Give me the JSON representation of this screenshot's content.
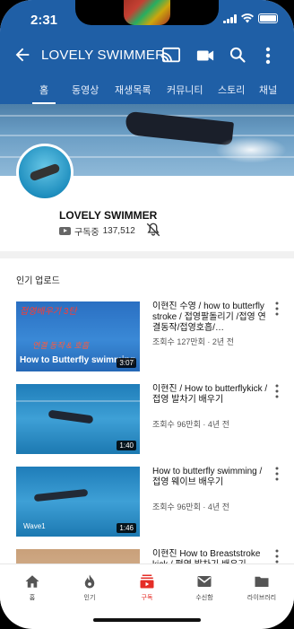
{
  "status_bar": {
    "time": "2:31"
  },
  "appbar": {
    "title": "LOVELY SWIMMER"
  },
  "tabs": [
    {
      "label": "홈",
      "active": true
    },
    {
      "label": "동영상"
    },
    {
      "label": "재생목록"
    },
    {
      "label": "커뮤니티"
    },
    {
      "label": "스토리"
    },
    {
      "label": "채널"
    }
  ],
  "channel": {
    "name": "LOVELY SWIMMER",
    "subscribe_label": "구독중",
    "subscriber_count": "137,512"
  },
  "section_title": "인기 업로드",
  "videos": [
    {
      "title": "이현진 수영 / how to butterfly stroke / 접영팔돌리기 /접영 연결동작/접영호흡/…",
      "meta": "조회수 127만회 · 2년 전",
      "duration": "3:07",
      "thumb_text_top": "접영배우기 3탄",
      "thumb_text_mid": "연결 동작 & 호흡",
      "thumb_text_bottom": "How to Butterfly swimming"
    },
    {
      "title": "이현진 / How to butterflykick /접영 발차기 배우기",
      "meta": "조회수 96만회 · 4년 전",
      "duration": "1:40"
    },
    {
      "title": "How to butterfly swimming / 접영 웨이브 배우기",
      "meta": "조회수 96만회 · 4년 전",
      "duration": "1:46",
      "thumb_text": "Wave1"
    },
    {
      "title": "이현진 How to Breaststroke kick / 평영 발차기 배우기",
      "meta": ""
    }
  ],
  "bottom_nav": [
    {
      "label": "홈",
      "icon": "home-icon"
    },
    {
      "label": "인기",
      "icon": "flame-icon"
    },
    {
      "label": "구독",
      "icon": "subscriptions-icon",
      "active": true
    },
    {
      "label": "수신함",
      "icon": "inbox-icon"
    },
    {
      "label": "라이브러리",
      "icon": "library-icon"
    }
  ],
  "colors": {
    "header_blue": "#1f5fa6",
    "accent_red": "#e52d27"
  }
}
